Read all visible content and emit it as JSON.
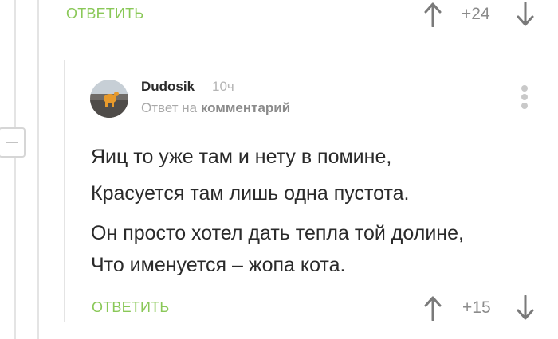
{
  "top_comment": {
    "reply_label": "ОТВЕТИТЬ",
    "score": "+24"
  },
  "comment": {
    "username": "Dudosik",
    "time": "10ч",
    "reply_prefix": "Ответ на",
    "reply_target": "комментарий",
    "lines": [
      "Яиц то уже там и нету в помине,",
      "Красуется там лишь одна пустота.",
      "Он просто хотел дать тепла той долине,",
      "Что именуется – жопа кота."
    ],
    "reply_label": "ОТВЕТИТЬ",
    "score": "+15"
  },
  "icons": {
    "upvote": "arrow-up-icon",
    "downvote": "arrow-down-icon",
    "more": "more-vertical-icon",
    "collapse": "minus-icon"
  },
  "colors": {
    "accent_green": "#8ac858",
    "text": "#2a2a2a",
    "muted": "#a9a9a9",
    "thread_line": "#e4e4e4"
  }
}
